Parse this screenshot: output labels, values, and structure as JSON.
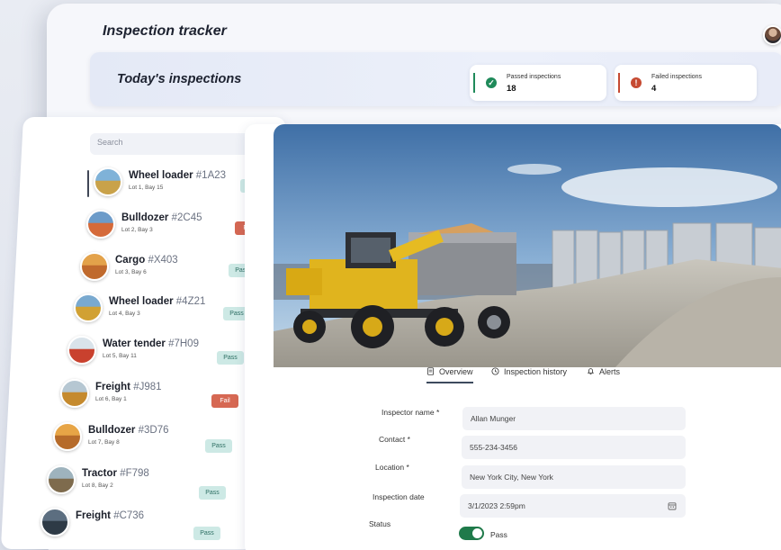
{
  "app": {
    "title": "Inspection tracker"
  },
  "banner": {
    "title": "Today's inspections",
    "passed": {
      "label": "Passed inspections",
      "value": "18",
      "color": "#1f8a5a"
    },
    "failed": {
      "label": "Failed inspections",
      "value": "4",
      "color": "#c64a32"
    }
  },
  "search": {
    "placeholder": "Search"
  },
  "list": [
    {
      "name": "Wheel loader",
      "id": "#1A23",
      "location": "Lot 1, Bay 15",
      "status": "Pass"
    },
    {
      "name": "Bulldozer",
      "id": "#2C45",
      "location": "Lot 2, Bay 3",
      "status": "Fail"
    },
    {
      "name": "Cargo",
      "id": "#X403",
      "location": "Lot 3, Bay 6",
      "status": "Pass"
    },
    {
      "name": "Wheel loader",
      "id": "#4Z21",
      "location": "Lot 4, Bay 3",
      "status": "Pass"
    },
    {
      "name": "Water tender",
      "id": "#7H09",
      "location": "Lot 5, Bay 11",
      "status": "Pass"
    },
    {
      "name": "Freight",
      "id": "#J981",
      "location": "Lot 6, Bay 1",
      "status": "Fail"
    },
    {
      "name": "Bulldozer",
      "id": "#3D76",
      "location": "Lot 7, Bay 8",
      "status": "Pass"
    },
    {
      "name": "Tractor",
      "id": "#F798",
      "location": "Lot 8, Bay 2",
      "status": "Pass"
    },
    {
      "name": "Freight",
      "id": "#C736",
      "location": "",
      "status": "Pass"
    }
  ],
  "tabs": [
    {
      "label": "Overview",
      "icon": "document-icon"
    },
    {
      "label": "Inspection history",
      "icon": "history-icon"
    },
    {
      "label": "Alerts",
      "icon": "bell-icon"
    }
  ],
  "form": {
    "inspector_name": {
      "label": "Inspector name *",
      "value": "Allan Munger"
    },
    "contact": {
      "label": "Contact *",
      "value": "555-234-3456"
    },
    "location": {
      "label": "Location *",
      "value": "New York City, New York"
    },
    "inspection_date": {
      "label": "Inspection date",
      "value": "3/1/2023 2:59pm"
    },
    "status": {
      "label": "Status",
      "value": "Pass"
    }
  }
}
